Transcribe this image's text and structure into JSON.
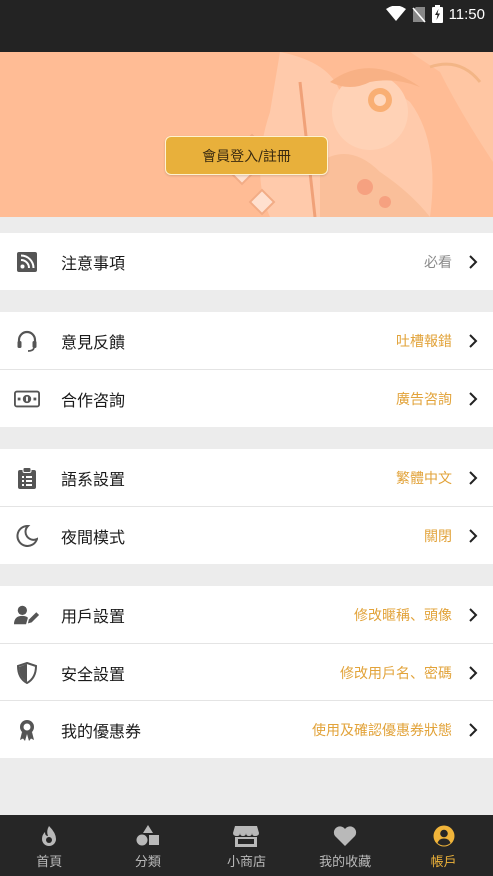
{
  "status_bar": {
    "time": "11:50"
  },
  "banner": {
    "login_label": "會員登入/註冊"
  },
  "menu": {
    "notice": {
      "label": "注意事項",
      "value": "必看"
    },
    "feedback": {
      "label": "意見反饋",
      "value": "吐槽報錯"
    },
    "cooperation": {
      "label": "合作咨詢",
      "value": "廣告咨詢"
    },
    "language": {
      "label": "語系設置",
      "value": "繁體中文"
    },
    "night_mode": {
      "label": "夜間模式",
      "value": "關閉"
    },
    "user_settings": {
      "label": "用戶設置",
      "value": "修改暱稱、頭像"
    },
    "security": {
      "label": "安全設置",
      "value": "修改用戶名、密碼"
    },
    "coupons": {
      "label": "我的優惠券",
      "value": "使用及確認優惠券狀態"
    }
  },
  "tabs": [
    {
      "label": "首頁",
      "icon": "fire-icon"
    },
    {
      "label": "分類",
      "icon": "shapes-icon"
    },
    {
      "label": "小商店",
      "icon": "store-icon"
    },
    {
      "label": "我的收藏",
      "icon": "heart-icon"
    },
    {
      "label": "帳戶",
      "icon": "account-icon",
      "active": true
    }
  ],
  "colors": {
    "accent": "#e8b03b",
    "banner_bg": "#ffbc95",
    "tabbar_bg": "#262626"
  }
}
